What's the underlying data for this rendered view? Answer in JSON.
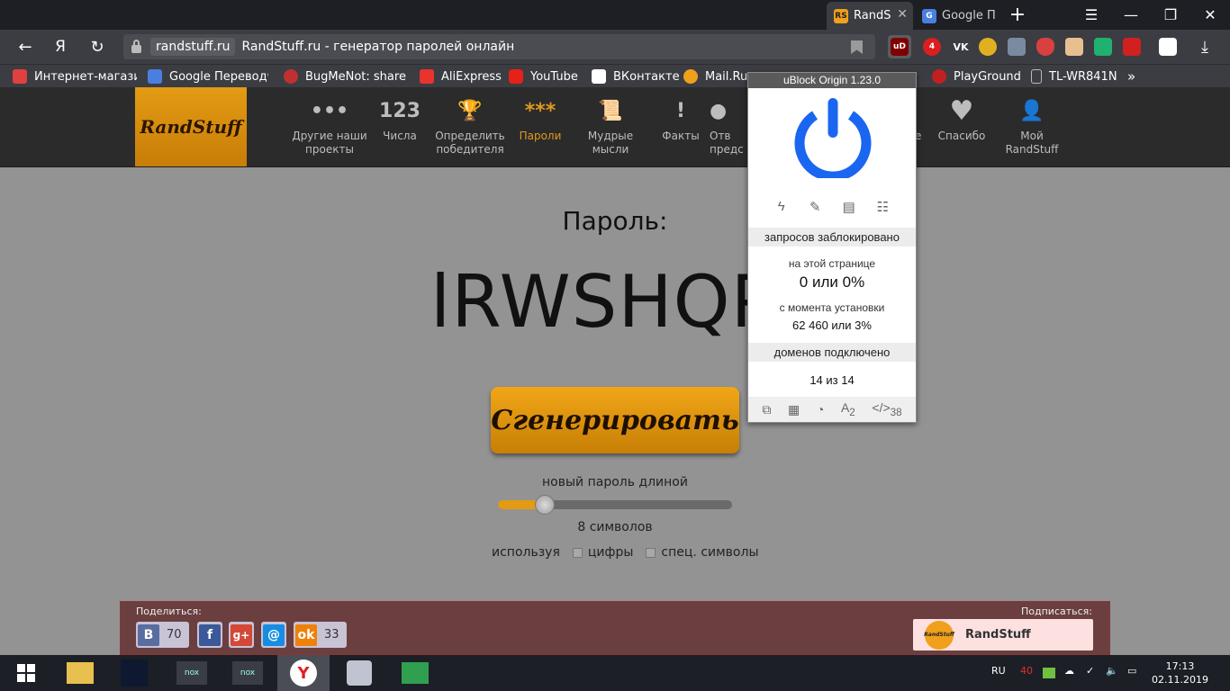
{
  "browser": {
    "tabs": [
      {
        "label": "RandS",
        "favicon": "RS",
        "active": true
      },
      {
        "label": "Google П",
        "favicon": "G",
        "active": false
      }
    ],
    "new_tab": "+",
    "url_domain": "randstuff.ru",
    "page_title": "RandStuff.ru - генератор паролей онлайн",
    "yandex_button": "Я",
    "extensions": [
      {
        "name": "ublock-origin",
        "text": "uD"
      },
      {
        "name": "adblock",
        "text": "4"
      },
      {
        "name": "vk",
        "text": "VK"
      }
    ],
    "bookmarks": [
      {
        "label": "Интернет-магазин",
        "icon": "cart-icon"
      },
      {
        "label": "Google Переводч",
        "icon": "google-translate-icon"
      },
      {
        "label": "BugMeNot: share l",
        "icon": "bug-icon"
      },
      {
        "label": "AliExpress",
        "icon": "aliexpress-icon"
      },
      {
        "label": "YouTube",
        "icon": "youtube-icon"
      },
      {
        "label": "ВКонтакте",
        "icon": "vk-icon"
      },
      {
        "label": "Mail.Ru",
        "icon": "mailru-icon"
      },
      {
        "label": "PlayGround",
        "icon": "playground-icon"
      },
      {
        "label": "TL-WR841N",
        "icon": "page-icon"
      }
    ],
    "bookmarks_more": "»"
  },
  "site": {
    "logo": "RandStuff",
    "nav": [
      {
        "label": "Другие наши проекты",
        "icon": "•••"
      },
      {
        "label": "Числа",
        "icon": "123"
      },
      {
        "label": "Определить победителя",
        "icon": "🏆"
      },
      {
        "label": "Пароли",
        "icon": "***"
      },
      {
        "label": "Мудрые мысли",
        "icon": "📜"
      },
      {
        "label": "Факты",
        "icon": "!"
      },
      {
        "label": "Отв предс",
        "icon": "●"
      },
      {
        "label": "е",
        "icon": ""
      },
      {
        "label": "Спасибо",
        "icon": "♥"
      },
      {
        "label": "Мой RandStuff",
        "icon": "👤"
      }
    ]
  },
  "generator": {
    "password_label": "Пароль:",
    "password_value": "lRWSHQP",
    "generate_button": "Сгенерировать",
    "length_label": "новый пароль длиной",
    "length_value": "8 символов",
    "length_fraction": 0.2,
    "using_label": "используя",
    "digits_label": "цифры",
    "special_label": "спец. символы"
  },
  "share": {
    "share_label": "Поделиться:",
    "subscribe_label": "Подписаться:",
    "vk_count": "70",
    "ok_count": "33",
    "subscribe_name": "RandStuff",
    "subscribe_logo": "RandStuff"
  },
  "ublock": {
    "title": "uBlock Origin 1.23.0",
    "blocked_header": "запросов заблокировано",
    "on_page_label": "на этой странице",
    "on_page_value": "0 или 0%",
    "since_install_label": "с момента установки",
    "since_install_value": "62 460 или 3%",
    "domains_header": "доменов подключено",
    "domains_value": "14 из 14",
    "font_badge": "2",
    "script_badge": "38"
  },
  "taskbar": {
    "lang": "RU",
    "time": "17:13",
    "date": "02.11.2019",
    "tray_number": "40"
  }
}
